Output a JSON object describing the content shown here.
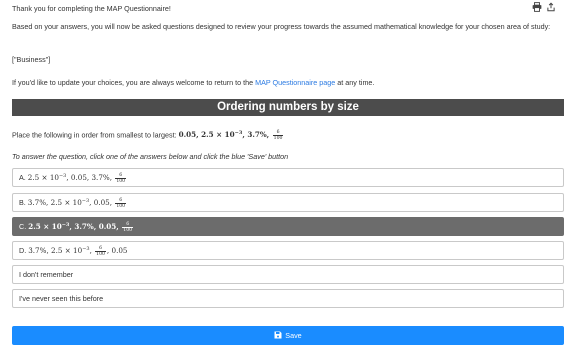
{
  "header": {
    "thanks": "Thank you for completing the MAP Questionnaire!"
  },
  "toolbar": {
    "print_icon": "print-icon",
    "export_icon": "share-icon"
  },
  "intro": {
    "text": "Based on your answers, you will now be asked questions designed to review your progress towards the assumed mathematical knowledge for your chosen area of study:",
    "subject": "[\"Business\"]",
    "update_prefix": "If you'd like to update your choices, you are always welcome to return to the ",
    "update_link": "MAP Questionnaire page",
    "update_suffix": " at any time."
  },
  "section": {
    "title": "Ordering numbers by size"
  },
  "question": {
    "prompt": "Place the following in order from smallest to largest: ",
    "values_math": "0.05, 2.5 × 10",
    "exp": "−3",
    "pct_part": ", 3.7%, ",
    "frac_num": "6",
    "frac_den": "100",
    "instruction": "To answer the question, click one of the answers below and click the blue 'Save' button"
  },
  "options": [
    {
      "label": "A.",
      "part1": "2.5 × 10",
      "exp": "−3",
      "part2": ", 0.05, 3.7%, ",
      "frac_num": "6",
      "frac_den": "100",
      "part3": "",
      "selected": false
    },
    {
      "label": "B.",
      "part1": "3.7%, 2.5 × 10",
      "exp": "−3",
      "part2": ", 0.05, ",
      "frac_num": "6",
      "frac_den": "100",
      "part3": "",
      "selected": false
    },
    {
      "label": "C.",
      "part1": "2.5 × 10",
      "exp": "−3",
      "part2": ", 3.7%, 0.05, ",
      "frac_num": "6",
      "frac_den": "100",
      "part3": "",
      "selected": true
    },
    {
      "label": "D.",
      "part1": "3.7%, 2.5 × 10",
      "exp": "−3",
      "part2": ", ",
      "frac_num": "6",
      "frac_den": "100",
      "part3": ", 0.05",
      "selected": false
    },
    {
      "label": "I don't remember"
    },
    {
      "label": "I've never seen this before"
    }
  ],
  "save": {
    "label": "Save",
    "icon": "save-icon"
  },
  "colors": {
    "heading_bg": "#4c4c4c",
    "selected_bg": "#6c6c6c",
    "save_bg": "#1a8cff",
    "link": "#2a7ae2"
  }
}
